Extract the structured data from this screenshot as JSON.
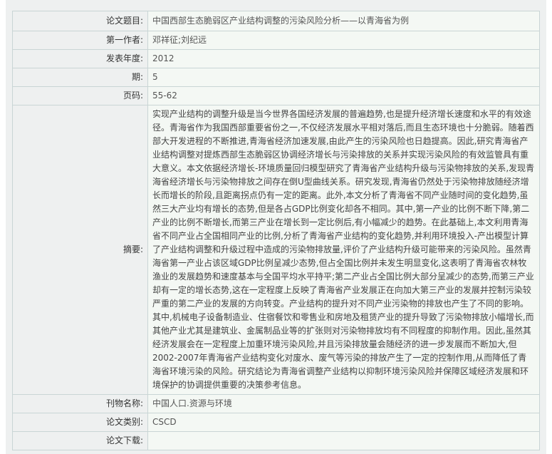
{
  "fields": {
    "title": {
      "label": "论文题目:",
      "value": "中国西部生态脆弱区产业结构调整的污染风险分析——以青海省为例"
    },
    "author": {
      "label": "第一作者:",
      "value": "邓祥征;刘纪远"
    },
    "year": {
      "label": "发表年度:",
      "value": "2012"
    },
    "issue": {
      "label": "期:",
      "value": "5"
    },
    "pages": {
      "label": "页码:",
      "value": "55-62"
    },
    "abstract": {
      "label": "摘要:",
      "value": "实现产业结构的调整升级是当今世界各国经济发展的普遍趋势,也是提升经济增长速度和水平的有效途径。青海省作为我国西部重要省份之一,不仅经济发展水平相对落后,而且生态环境也十分脆弱。随着西部大开发进程的不断推进,青海省经济加速发展,由此产生的污染风险也日趋提高。因此,研究青海省产业结构调整对提炼西部生态脆弱区协调经济增长与污染排放的关系并实现污染风险的有效监管具有重大意义。本文依据经济增长-环境质量回归模型研究了青海省产业结构升级与污染物排放的关系,发现青海省经济增长与污染物排放之间存在倒U型曲线关系。研究发现,青海省仍然处于污染物排放随经济增长而增长的阶段,且距离拐点仍有一定的距离。此外,本文分析了青海省不同产业随时间的变化趋势,虽然三大产业均有增长的态势,但是各占GDP比例变化却各不相同。其中,第一产业的比例不断下降,第二产业的比例不断增长,而第三产业在增长到一定比例后,有小幅减少的趋势。在此基础上,本文利用青海省不同产业占全国相同产业的比例,分析了青海省产业结构的变化趋势,并利用环境投入-产出模型计算了产业结构调整和升级过程中造成的污染物排放量,评价了产业结构升级可能带来的污染风险。虽然青海省第一产业占该区域GDP比例呈减少态势,但占全国比例并未发生明显变化,这表明了青海省农林牧渔业的发展趋势和速度基本与全国平均水平持平;第二产业占全国比例大部分呈减少的态势,而第三产业却有一定的增长态势,这在一定程度上反映了青海省产业发展正在向加大第三产业的发展并控制污染较严重的第二产业的发展的方向转变。产业结构的提升对不同产业污染物的排放也产生了不同的影响。其中,机械电子设备制造业、住宿餐饮和零售业和房地及租赁产业的提升导致了污染物排放小幅增长,而其他产业尤其是建筑业、金属制品业等的扩张则对污染物排放均有不同程度的抑制作用。因此,虽然其经济发展会在一定程度上加重环境污染风险,并且污染排放量会随经济的进一步发展而不断加大,但2002-2007年青海省产业结构变化对废水、废气等污染的排放产生了一定的控制作用,从而降低了青海省环境污染的风险。研究结论为青海省调整产业结构以抑制环境污染风险并保障区域经济发展和环境保护的协调提供重要的决策参考信息。"
    },
    "journal": {
      "label": "刊物名称:",
      "value": "中国人口.资源与环境"
    },
    "category": {
      "label": "论文类别:",
      "value": "CSCD"
    },
    "download": {
      "label": "论文下载:",
      "value": ""
    }
  }
}
